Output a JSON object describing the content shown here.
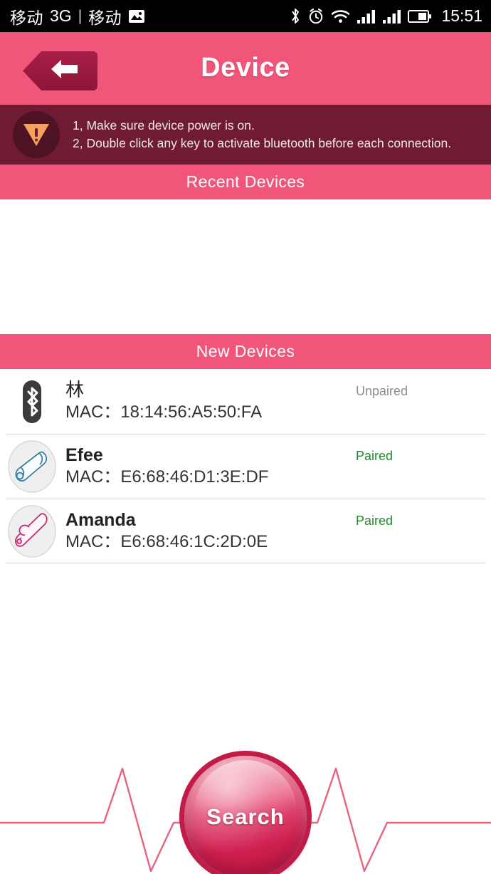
{
  "statusbar": {
    "carrier": "移动",
    "network": "3G",
    "separator": "|",
    "carrier2": "移动",
    "photo_icon": "photo-icon",
    "bluetooth_icon": "bluetooth-icon",
    "alarm_icon": "alarm-clock-icon",
    "wifi_icon": "wifi-icon",
    "signal1_icon": "signal-bars-icon",
    "signal2_icon": "signal-bars-icon",
    "battery_icon": "battery-icon",
    "time": "15:51"
  },
  "header": {
    "title": "Device",
    "back_icon": "back-arrow-icon"
  },
  "warning": {
    "icon": "warning-triangle-icon",
    "line1": "1, Make sure device power is on.",
    "line2": "2, Double click any key to activate bluetooth before each connection."
  },
  "sections": {
    "recent": {
      "title": "Recent Devices",
      "devices": []
    },
    "new": {
      "title": "New Devices",
      "devices": [
        {
          "name": "林",
          "mac_label": "MAC：18:14:56:A5:50:FA",
          "status": "Unpaired",
          "status_state": "unpaired",
          "icon": "bluetooth-device-icon",
          "is_cjk": true
        },
        {
          "name": "Efee",
          "mac_label": "MAC：E6:68:46:D1:3E:DF",
          "status": "Paired",
          "status_state": "paired",
          "icon": "blue-massager-device-icon",
          "is_cjk": false
        },
        {
          "name": "Amanda",
          "mac_label": "MAC：E6:68:46:1C:2D:0E",
          "status": "Paired",
          "status_state": "paired",
          "icon": "pink-massager-device-icon",
          "is_cjk": false
        }
      ]
    }
  },
  "bottom": {
    "search_label": "Search",
    "ecg_icon": "heartbeat-line-icon"
  },
  "colors": {
    "accent_pink": "#F2557A",
    "dark_maroon": "#6E1B33",
    "back_btn": "#A81D45",
    "paired_green": "#1F8A28",
    "unpaired_gray": "#8D8D8D",
    "warn_orange": "#F4A15D",
    "ecg_line": "#E8637F",
    "search_button": "#CF2050"
  }
}
